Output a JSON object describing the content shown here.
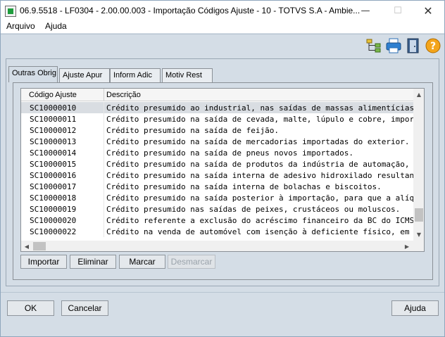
{
  "window": {
    "title": "06.9.5518 - LF0304 - 2.00.00.003 - Importação Códigos Ajuste - 10 - TOTVS S.A - Ambie...",
    "minimize_glyph": "—",
    "maximize_glyph": "☐",
    "close_glyph": "✕"
  },
  "menu": {
    "items": [
      "Arquivo",
      "Ajuda"
    ]
  },
  "toolbar": {
    "icons": [
      "tree-hierarchy-icon",
      "printer-icon",
      "exit-door-icon",
      "help-icon"
    ]
  },
  "tabs": [
    {
      "label": "Outras Obrig",
      "active": true
    },
    {
      "label": "Ajuste Apur",
      "active": false
    },
    {
      "label": "Inform Adic",
      "active": false
    },
    {
      "label": "Motiv Rest",
      "active": false
    }
  ],
  "grid": {
    "columns": [
      "Código Ajuste",
      "Descrição"
    ],
    "rows": [
      {
        "code": "SC10000010",
        "desc": "Crédito presumido ao industrial, nas saídas de massas alimentícias, biscoito"
      },
      {
        "code": "SC10000011",
        "desc": "Crédito presumido na saída de cevada, malte, lúpulo e cobre, importados d"
      },
      {
        "code": "SC10000012",
        "desc": "Crédito presumido na saída de feijão."
      },
      {
        "code": "SC10000013",
        "desc": "Crédito presumido na saída de mercadorias importadas do exterior."
      },
      {
        "code": "SC10000014",
        "desc": "Crédito presumido na saída de pneus novos importados."
      },
      {
        "code": "SC10000015",
        "desc": "Crédito presumido na saída de produtos da indústria de automação, informa"
      },
      {
        "code": "SC10000016",
        "desc": "Crédito presumido na saída interna de adesivo hidroxilado resultante de ga"
      },
      {
        "code": "SC10000017",
        "desc": "Crédito presumido na saída interna de bolachas e biscoitos."
      },
      {
        "code": "SC10000018",
        "desc": "Crédito presumido na saída posterior à importação, para que a alíquota res"
      },
      {
        "code": "SC10000019",
        "desc": "Crédito presumido nas saídas de peixes, crustáceos ou moluscos."
      },
      {
        "code": "SC10000020",
        "desc": "Crédito referente a exclusão do acréscimo financeiro da BC do ICMS"
      },
      {
        "code": "SC10000022",
        "desc": "Crédito na venda de automóvel com isenção à deficiente físico, em que o IC"
      }
    ],
    "selected_row": 0,
    "scroll_up": "▲",
    "scroll_down": "▼",
    "scroll_left": "◀",
    "scroll_right": "▶"
  },
  "grid_buttons": {
    "import": "Importar",
    "eliminate": "Eliminar",
    "mark": "Marcar",
    "unmark": "Desmarcar"
  },
  "footer_buttons": {
    "ok": "OK",
    "cancel": "Cancelar",
    "help": "Ajuda"
  }
}
